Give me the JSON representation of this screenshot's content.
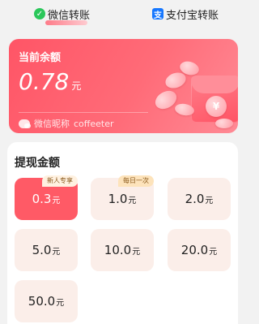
{
  "tabs": {
    "wechat_label": "微信转账",
    "alipay_label": "支付宝转账"
  },
  "balance": {
    "title": "当前余额",
    "amount": "0.78",
    "unit": "元",
    "nickname_label": "微信昵称",
    "nickname": "coffeeter"
  },
  "withdraw": {
    "title": "提现金额",
    "options": [
      {
        "amount": "0.3",
        "unit": "元",
        "tag": "新人专享",
        "selected": true
      },
      {
        "amount": "1.0",
        "unit": "元",
        "tag": "每日一次",
        "selected": false
      },
      {
        "amount": "2.0",
        "unit": "元",
        "tag": "",
        "selected": false
      },
      {
        "amount": "5.0",
        "unit": "元",
        "tag": "",
        "selected": false
      },
      {
        "amount": "10.0",
        "unit": "元",
        "tag": "",
        "selected": false
      },
      {
        "amount": "20.0",
        "unit": "元",
        "tag": "",
        "selected": false
      },
      {
        "amount": "50.0",
        "unit": "元",
        "tag": "",
        "selected": false
      }
    ]
  },
  "colors": {
    "accent": "#ff5a66",
    "option_bg": "#fbeee9",
    "tag_bg": "#fde3bb",
    "wechat_green": "#2ac75a",
    "alipay_blue": "#1677ff"
  },
  "icons": {
    "coin_symbol": "¥"
  }
}
